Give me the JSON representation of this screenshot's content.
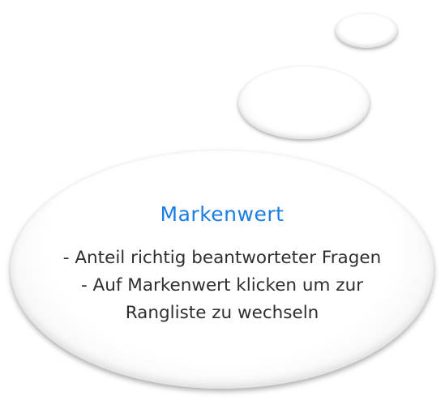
{
  "colors": {
    "title": "#1a7de6",
    "text": "#2e2e2e"
  },
  "bubble": {
    "title": "Markenwert",
    "lines": [
      "- Anteil richtig beantworteter Fragen",
      "- Auf Markenwert klicken um zur",
      "Rangliste zu wechseln"
    ]
  }
}
